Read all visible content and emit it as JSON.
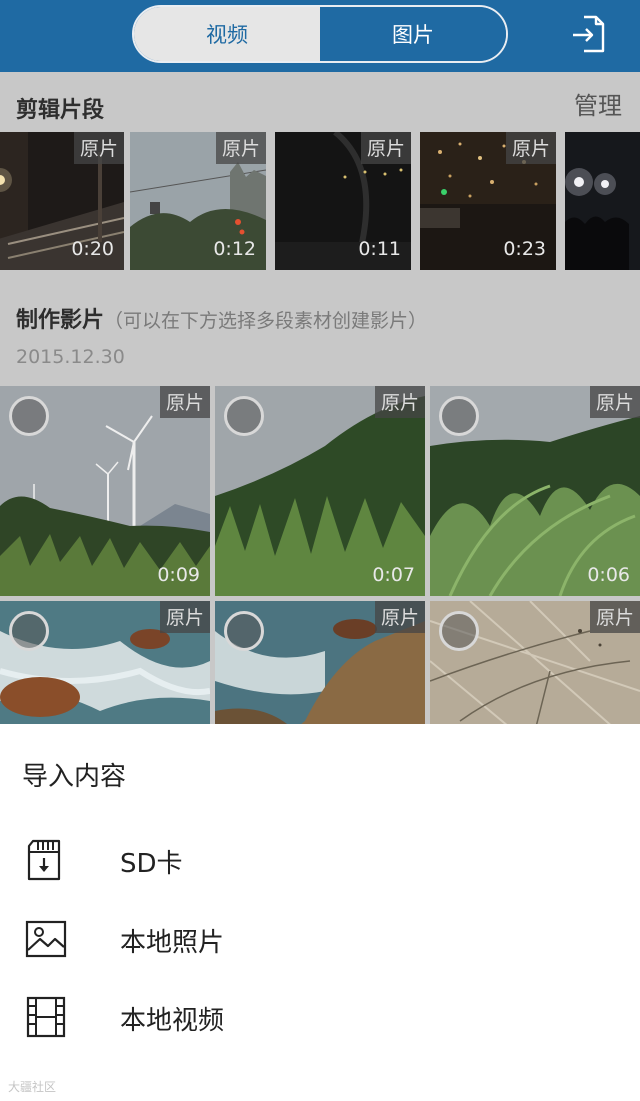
{
  "header": {
    "tabs": [
      {
        "label": "视频",
        "active": true
      },
      {
        "label": "图片",
        "active": false
      }
    ],
    "export_icon": "export-icon",
    "colors": {
      "primary": "#1f6aa3",
      "tab_active_bg": "#e6e6e6"
    }
  },
  "clips_section": {
    "title": "剪辑片段",
    "manage_label": "管理",
    "clips": [
      {
        "badge": "原片",
        "duration": "0:20"
      },
      {
        "badge": "原片",
        "duration": "0:12"
      },
      {
        "badge": "原片",
        "duration": "0:11"
      },
      {
        "badge": "原片",
        "duration": "0:23"
      },
      {
        "badge": "",
        "duration": ""
      }
    ]
  },
  "make_section": {
    "title": "制作影片",
    "hint": "（可以在下方选择多段素材创建影片）",
    "date": "2015.12.30",
    "tiles": [
      {
        "badge": "原片",
        "duration": "0:09"
      },
      {
        "badge": "原片",
        "duration": "0:07"
      },
      {
        "badge": "原片",
        "duration": "0:06"
      },
      {
        "badge": "原片",
        "duration": ""
      },
      {
        "badge": "原片",
        "duration": ""
      },
      {
        "badge": "原片",
        "duration": ""
      }
    ]
  },
  "import_sheet": {
    "title": "导入内容",
    "options": [
      {
        "label": "SD卡",
        "icon": "sd-card-icon"
      },
      {
        "label": "本地照片",
        "icon": "photo-icon"
      },
      {
        "label": "本地视频",
        "icon": "film-icon"
      }
    ]
  },
  "watermark": "大疆社区"
}
